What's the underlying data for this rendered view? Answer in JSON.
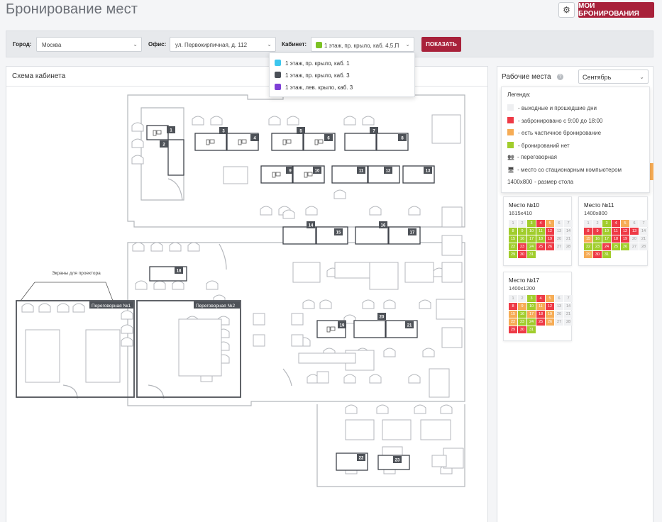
{
  "header": {
    "title": "Бронирование мест",
    "star_icon": "☆",
    "settings_icon": "⚙",
    "my_bookings_label": "МОИ БРОНИРОВАНИЯ"
  },
  "filters": {
    "city_label": "Город:",
    "city_value": "Москва",
    "office_label": "Офис:",
    "office_value": "ул. Первокирпичная, д. 112",
    "room_label": "Кабинет:",
    "room_value": "1 этаж, пр. крыло, каб. 4,5,П",
    "room_color": "#7cc224",
    "show_label": "ПОКАЗАТЬ",
    "chevron": "⌄"
  },
  "room_options": [
    {
      "label": "1 этаж, пр. крыло, каб. 1",
      "color": "#3cc6ee"
    },
    {
      "label": "1 этаж, пр. крыло, каб. 3",
      "color": "#4b5058"
    },
    {
      "label": "1 этаж, лев. крыло, каб. 3",
      "color": "#7e3fd6"
    }
  ],
  "schema": {
    "title": "Схема кабинета",
    "projector_note": "Экраны для проектора",
    "meeting_rooms": [
      "Переговорная №1",
      "Переговорная №2"
    ],
    "desk_numbers": [
      "1",
      "2",
      "3",
      "4",
      "5",
      "6",
      "7",
      "8",
      "9",
      "10",
      "11",
      "12",
      "13",
      "14",
      "15",
      "16",
      "17",
      "18",
      "19",
      "20",
      "21",
      "22",
      "23"
    ]
  },
  "workplaces": {
    "title": "Рабочие места",
    "info_icon": "?",
    "month": "Сентябрь",
    "legend_title": "Легенда:",
    "legend": [
      {
        "text": "- выходные и прошедшие дни",
        "color": "#eeeff1"
      },
      {
        "text": "- забронировано с 9:00 до 18:00",
        "color": "#ee3a46"
      },
      {
        "text": "- есть частичное бронирование",
        "color": "#f6ac55"
      },
      {
        "text": "- бронирований нет",
        "color": "#a1cd2c"
      },
      {
        "text": "- переговорная",
        "icon": "👥"
      },
      {
        "text": "- место со стационарным компьютером",
        "icon": "🖥"
      },
      {
        "text": "- размер стола",
        "prefix": "1400x800"
      }
    ],
    "calendars": [
      {
        "title": "Место №10",
        "size": "1615x410",
        "days": [
          {
            "n": "1",
            "s": "g"
          },
          {
            "n": "2",
            "s": "g"
          },
          {
            "n": "3",
            "s": "l"
          },
          {
            "n": "4",
            "s": "r"
          },
          {
            "n": "5",
            "s": "o"
          },
          {
            "n": "6",
            "s": "g"
          },
          {
            "n": "7",
            "s": "g"
          },
          {
            "n": "8",
            "s": "l"
          },
          {
            "n": "9",
            "s": "l"
          },
          {
            "n": "10",
            "s": "l"
          },
          {
            "n": "11",
            "s": "l"
          },
          {
            "n": "12",
            "s": "r"
          },
          {
            "n": "13",
            "s": "g"
          },
          {
            "n": "14",
            "s": "g"
          },
          {
            "n": "15",
            "s": "l"
          },
          {
            "n": "16",
            "s": "l"
          },
          {
            "n": "17",
            "s": "l"
          },
          {
            "n": "18",
            "s": "l"
          },
          {
            "n": "19",
            "s": "r"
          },
          {
            "n": "20",
            "s": "g"
          },
          {
            "n": "21",
            "s": "g"
          },
          {
            "n": "22",
            "s": "l"
          },
          {
            "n": "23",
            "s": "r"
          },
          {
            "n": "24",
            "s": "l"
          },
          {
            "n": "25",
            "s": "r"
          },
          {
            "n": "26",
            "s": "r"
          },
          {
            "n": "27",
            "s": "g"
          },
          {
            "n": "28",
            "s": "g"
          },
          {
            "n": "29",
            "s": "l"
          },
          {
            "n": "30",
            "s": "r"
          },
          {
            "n": "31",
            "s": "l"
          }
        ]
      },
      {
        "title": "Место №11",
        "size": "1400x800",
        "days": [
          {
            "n": "1",
            "s": "g"
          },
          {
            "n": "2",
            "s": "g"
          },
          {
            "n": "3",
            "s": "l"
          },
          {
            "n": "4",
            "s": "r"
          },
          {
            "n": "5",
            "s": "o"
          },
          {
            "n": "6",
            "s": "g"
          },
          {
            "n": "7",
            "s": "g"
          },
          {
            "n": "8",
            "s": "r"
          },
          {
            "n": "9",
            "s": "r"
          },
          {
            "n": "10",
            "s": "l"
          },
          {
            "n": "11",
            "s": "r"
          },
          {
            "n": "12",
            "s": "r"
          },
          {
            "n": "13",
            "s": "r"
          },
          {
            "n": "14",
            "s": "g"
          },
          {
            "n": "15",
            "s": "o"
          },
          {
            "n": "16",
            "s": "l"
          },
          {
            "n": "17",
            "s": "l"
          },
          {
            "n": "18",
            "s": "r"
          },
          {
            "n": "19",
            "s": "r"
          },
          {
            "n": "20",
            "s": "g"
          },
          {
            "n": "21",
            "s": "g"
          },
          {
            "n": "22",
            "s": "l"
          },
          {
            "n": "23",
            "s": "l"
          },
          {
            "n": "24",
            "s": "r"
          },
          {
            "n": "25",
            "s": "l"
          },
          {
            "n": "26",
            "s": "l"
          },
          {
            "n": "27",
            "s": "g"
          },
          {
            "n": "28",
            "s": "g"
          },
          {
            "n": "29",
            "s": "o"
          },
          {
            "n": "30",
            "s": "r"
          },
          {
            "n": "31",
            "s": "l"
          }
        ]
      },
      {
        "title": "Место №17",
        "size": "1400x1200",
        "days": [
          {
            "n": "1",
            "s": "g"
          },
          {
            "n": "2",
            "s": "g"
          },
          {
            "n": "3",
            "s": "l"
          },
          {
            "n": "4",
            "s": "r"
          },
          {
            "n": "5",
            "s": "o"
          },
          {
            "n": "6",
            "s": "g"
          },
          {
            "n": "7",
            "s": "g"
          },
          {
            "n": "8",
            "s": "r"
          },
          {
            "n": "9",
            "s": "o"
          },
          {
            "n": "10",
            "s": "l"
          },
          {
            "n": "11",
            "s": "o"
          },
          {
            "n": "12",
            "s": "r"
          },
          {
            "n": "13",
            "s": "g"
          },
          {
            "n": "14",
            "s": "g"
          },
          {
            "n": "15",
            "s": "o"
          },
          {
            "n": "16",
            "s": "l"
          },
          {
            "n": "17",
            "s": "o"
          },
          {
            "n": "18",
            "s": "r"
          },
          {
            "n": "19",
            "s": "o"
          },
          {
            "n": "20",
            "s": "g"
          },
          {
            "n": "21",
            "s": "g"
          },
          {
            "n": "22",
            "s": "o"
          },
          {
            "n": "23",
            "s": "l"
          },
          {
            "n": "24",
            "s": "l"
          },
          {
            "n": "25",
            "s": "r"
          },
          {
            "n": "26",
            "s": "o"
          },
          {
            "n": "27",
            "s": "g"
          },
          {
            "n": "28",
            "s": "g"
          },
          {
            "n": "29",
            "s": "r"
          },
          {
            "n": "30",
            "s": "r"
          },
          {
            "n": "31",
            "s": "l"
          }
        ]
      }
    ]
  }
}
